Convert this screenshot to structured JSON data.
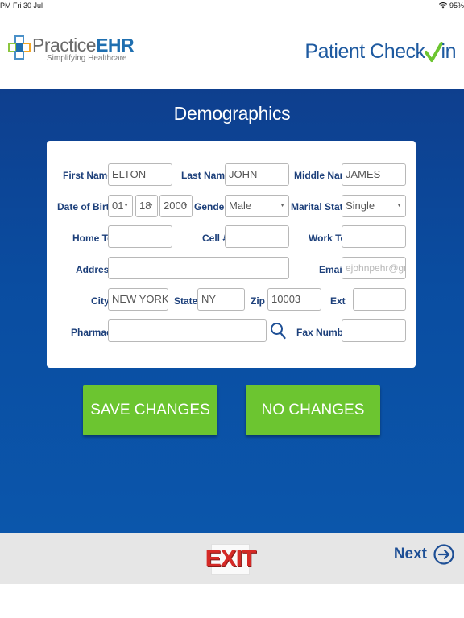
{
  "status": {
    "time": "PM  Fri 30 Jul",
    "battery": "95%"
  },
  "header": {
    "brand_plain": "Practice",
    "brand_bold": "EHR",
    "tagline": "Simplifying Healthcare",
    "checkin_left": "Patient Check",
    "checkin_right": "in"
  },
  "section_title": "Demographics",
  "labels": {
    "first_name": "First Name",
    "last_name": "Last Name",
    "middle_name": "Middle Name",
    "dob": "Date of Birth",
    "gender": "Gender",
    "marital": "Marital Status",
    "home_tel": "Home Tel",
    "cell": "Cell #",
    "work_tel": "Work Tel",
    "address": "Address",
    "email": "Email",
    "city": "City",
    "state": "State",
    "zip": "Zip",
    "ext": "Ext",
    "pharmacy": "Pharmacy",
    "fax": "Fax Number"
  },
  "values": {
    "first_name": "ELTON",
    "last_name": "JOHN",
    "middle_name": "JAMES",
    "dob_month": "01",
    "dob_day": "18",
    "dob_year": "2000",
    "gender": "Male",
    "marital": "Single",
    "home_tel": "",
    "cell": "",
    "work_tel": "",
    "address": "",
    "email_placeholder": "ejohnpehr@gm",
    "city": "NEW YORK",
    "state": "NY",
    "zip": "10003",
    "ext": "",
    "pharmacy": "",
    "fax": ""
  },
  "buttons": {
    "save": "SAVE CHANGES",
    "no_changes": "NO CHANGES",
    "exit": "EXIT",
    "next": "Next"
  },
  "colors": {
    "brand_blue": "#1e5aa0",
    "panel_blue": "#0a4da1",
    "button_green": "#6cc530",
    "exit_red": "#d52a27",
    "required_marker": "#e0413e"
  },
  "icons": {
    "wifi": "wifi-icon",
    "search": "search-icon",
    "next": "arrow-right-circle-icon",
    "check": "checkmark-icon",
    "logo": "medical-cross-icon"
  }
}
